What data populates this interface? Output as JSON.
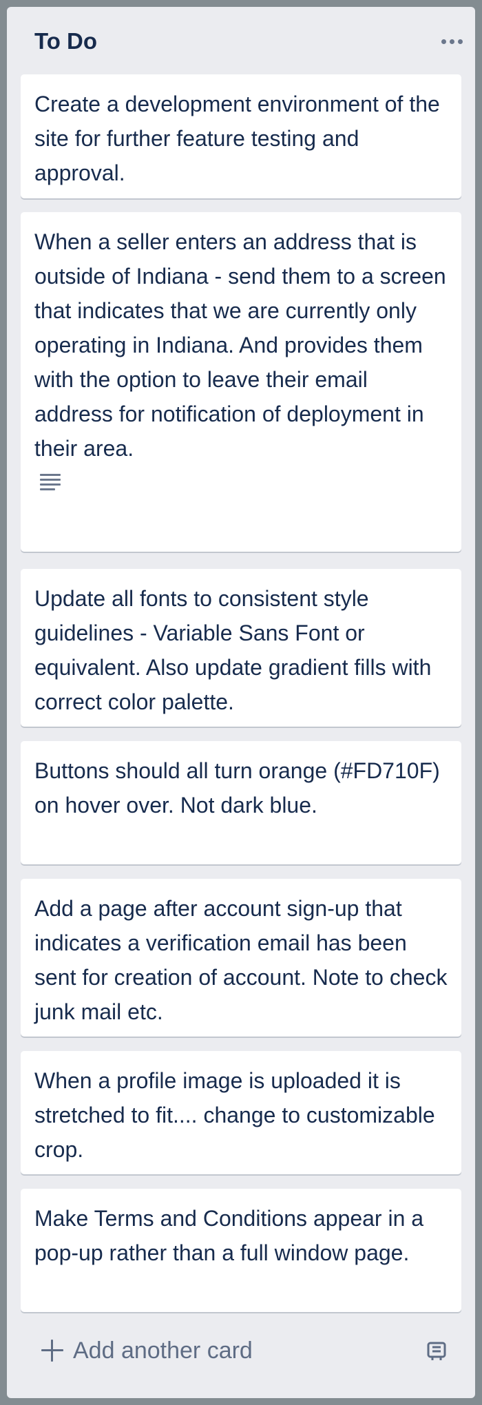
{
  "list": {
    "title": "To Do",
    "menu_icon": "more-horizontal-icon"
  },
  "cards": [
    {
      "text": "Create a development environment of the site for further feature testing and approval.",
      "has_description": false
    },
    {
      "text": "When a seller enters an address that is outside of Indiana - send them to a screen that indicates that we are currently only operating in Indiana. And provides them with the option to leave their email address for notification of deployment in their area.",
      "has_description": true
    },
    {
      "text": "Update all fonts to consistent style guidelines - Variable Sans Font or equivalent. Also update gradient fills with correct color palette.",
      "has_description": false
    },
    {
      "text": "Buttons should all turn orange (#FD710F) on hover over. Not dark blue.",
      "has_description": false
    },
    {
      "text": "Add a page after account sign-up that indicates a verification email has been sent for creation of account. Note to check junk mail etc.",
      "has_description": false
    },
    {
      "text": "When a profile image is uploaded it is stretched to fit.... change to customizable crop.",
      "has_description": false
    },
    {
      "text": "Make Terms and Conditions appear in a pop-up rather than a full window page.",
      "has_description": false
    }
  ],
  "footer": {
    "add_card_label": "Add another card",
    "add_icon": "plus-icon",
    "template_icon": "card-template-icon"
  },
  "colors": {
    "board_background": "#838c91",
    "list_background": "#ebecf0",
    "card_background": "#ffffff",
    "text_primary": "#172b4d",
    "text_secondary": "#5e6c84"
  }
}
